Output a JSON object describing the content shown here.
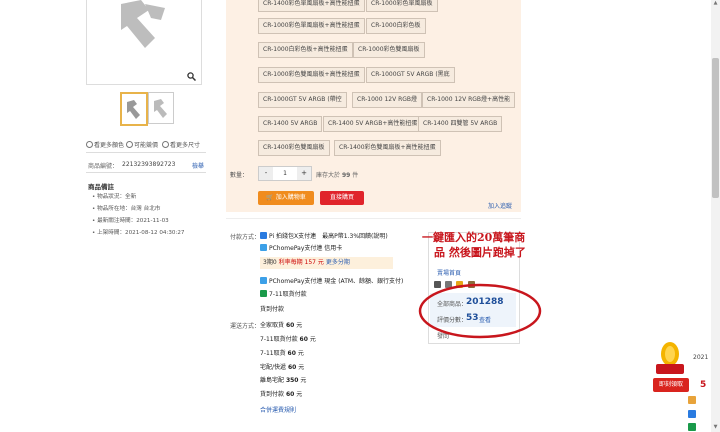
{
  "left": {
    "info_links": [
      "看更多顏色",
      "可能競價",
      "看更多尺寸"
    ],
    "product_no_label": "商品編號：",
    "product_no": "22132393892723",
    "report_link": "檢舉",
    "notes_title": "商品備註",
    "notes": [
      "物品狀況：全新",
      "物品所在地：台灣 台北市",
      "最新關注時間：2021-11-03",
      "上架時間：2021-08-12 04:30:27"
    ]
  },
  "options": {
    "chips": [
      "CR-1400彩色單風扇板+高性能扭蛋",
      "CR-1000彩色單風扇板",
      "CR-1000彩色單風扇板+高性能扭蛋",
      "CR-1000白彩色板",
      "CR-1000白彩色板+高性能扭蛋",
      "CR-1000彩色雙風扇板",
      "CR-1000彩色雙風扇板+高性能扭蛋",
      "CR-1000GT 5V ARGB (黑底",
      "CR-1000GT 5V ARGB (帶控",
      "CR-1000 12V RGB燈",
      "CR-1000 12V RGB燈+高性能",
      "CR-1400 5V ARGB",
      "CR-1400 5V ARGB+高性能扭蛋",
      "CR-1400 四雙管 5V ARGB",
      "CR-1400彩色雙風扇板",
      "CR-1400彩色雙風扇板+高性能扭蛋"
    ],
    "qty_label": "數量：",
    "qty_minus": "-",
    "qty_value": "1",
    "qty_plus": "+",
    "stock_text": "庫存大於",
    "stock_num": "99",
    "stock_unit": "件",
    "add_cart": "加入購物車",
    "buy_now": "直接購買",
    "add_track": "加入追蹤"
  },
  "payment": {
    "label": "付款方式：",
    "pi_text": "Pi 拍錢包X支付連　最高P幣1.3%回饋(說明)",
    "pchome_card": "PChomePay支付連 信用卡",
    "installment_pre": "3期0",
    "installment_mid": "利率每期",
    "installment_amount": "157",
    "installment_post": "元",
    "installment_link": "更多分期",
    "pchome_other": "PChomePay支付連 現金 (ATM、餘額、銀行支付)",
    "seven_pay": "7-11取貨付款",
    "cod": "貨到付款"
  },
  "shipping": {
    "label": "運送方式：",
    "items": [
      {
        "name": "全家取貨",
        "price": "60"
      },
      {
        "name": "7-11取貨付款",
        "price": "60"
      },
      {
        "name": "7-11取貨",
        "price": "60"
      },
      {
        "name": "宅配/快遞",
        "price": "60"
      },
      {
        "name": "離島宅配",
        "price": "350"
      },
      {
        "name": "貨到付款",
        "price": "60"
      }
    ],
    "unit": "元",
    "policy_link": "合併運費規則"
  },
  "seller": {
    "about_link": "賣場首頁",
    "total_label": "全部商品：",
    "total_value": "201288",
    "score_label": "評價分數：",
    "score_value": "53",
    "score_link": "查看",
    "ask_link": "發問"
  },
  "annotation": {
    "line1": "一鍵匯入的20萬筆商",
    "line2": "品 然後圖片跑掉了"
  },
  "promo": {
    "button": "即刻領取",
    "side_text": "2021",
    "side_num": "5"
  }
}
